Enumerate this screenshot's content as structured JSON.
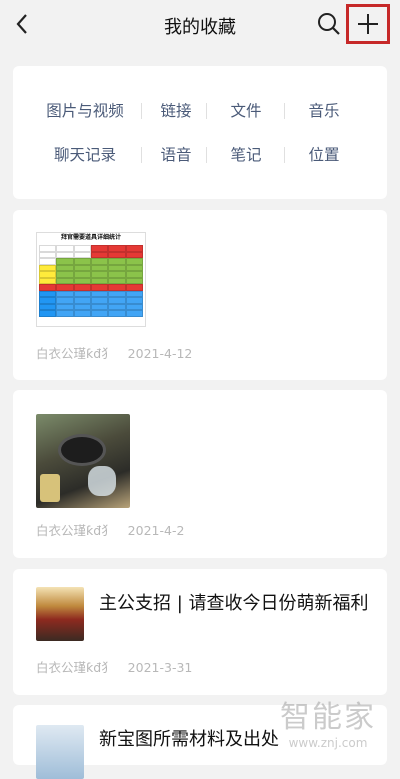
{
  "header": {
    "title": "我的收藏",
    "back_icon": "chevron-left-icon",
    "search_icon": "search-icon",
    "add_icon": "plus-icon"
  },
  "categories": {
    "row1": [
      "图片与视频",
      "链接",
      "文件",
      "音乐"
    ],
    "row2": [
      "聊天记录",
      "语音",
      "笔记",
      "位置"
    ]
  },
  "items": [
    {
      "type": "image",
      "thumb_title": "拜官需要道具详细统计",
      "author": "白衣公瑾ƙđ犭",
      "date": "2021-4-12"
    },
    {
      "type": "video",
      "author": "白衣公瑾ƙđ犭",
      "date": "2021-4-2"
    },
    {
      "type": "article",
      "title": "主公支招 | 请查收今日份萌新福利",
      "author": "白衣公瑾ƙđ犭",
      "date": "2021-3-31"
    },
    {
      "type": "article",
      "title": "新宝图所需材料及出处"
    }
  ],
  "watermark": {
    "big": "智能家",
    "small": "www.znj.com"
  },
  "colors": {
    "accent_red": "#c62828",
    "category_text": "#4a5a78",
    "meta_text": "#b8b8b8"
  }
}
